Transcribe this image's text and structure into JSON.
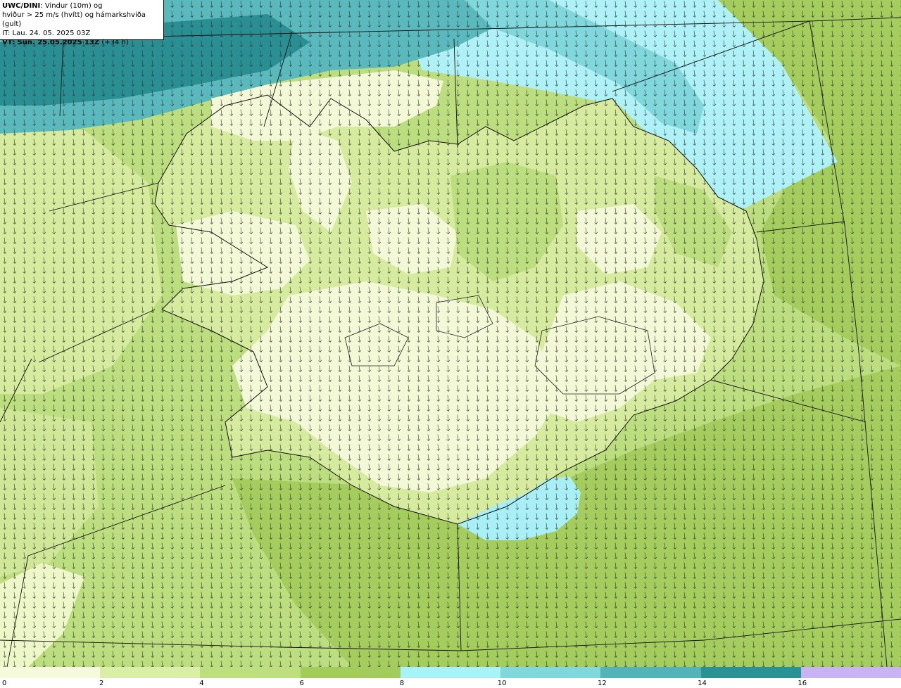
{
  "header": {
    "model": "UWC/DINI",
    "variable": ": Vindur (10m) og",
    "subtitle": "hviður > 25 m/s (hvítt) og hámarkshviða (gult)",
    "init_time": "IT: Lau. 24. 05. 2025 03Z",
    "valid_time": "VT: Sun. 25.05.2025 13Z",
    "lead_time": "(+34 h)"
  },
  "legend": {
    "ticks": [
      "0",
      "2",
      "4",
      "6",
      "8",
      "10",
      "12",
      "14",
      "16"
    ],
    "colors": [
      "#f5fadc",
      "#d9eea6",
      "#bedf80",
      "#a2cc5c",
      "#a8f2f8",
      "#80d8dc",
      "#52b4b8",
      "#2a9294",
      "#c8b4f0"
    ]
  },
  "map": {
    "region": "Iceland",
    "arrow_direction": "south-southwest",
    "colors": {
      "land_light": "#f3f9d6",
      "land_mid": "#d6eb9e",
      "sea_mid": "#bcde7e",
      "sea_strong": "#a4cd5e",
      "north_cyan": "#aef2f7",
      "north_teal": "#5ab9bc",
      "north_dark": "#2a8f92",
      "south_cyan": "#a8f0f6"
    }
  }
}
